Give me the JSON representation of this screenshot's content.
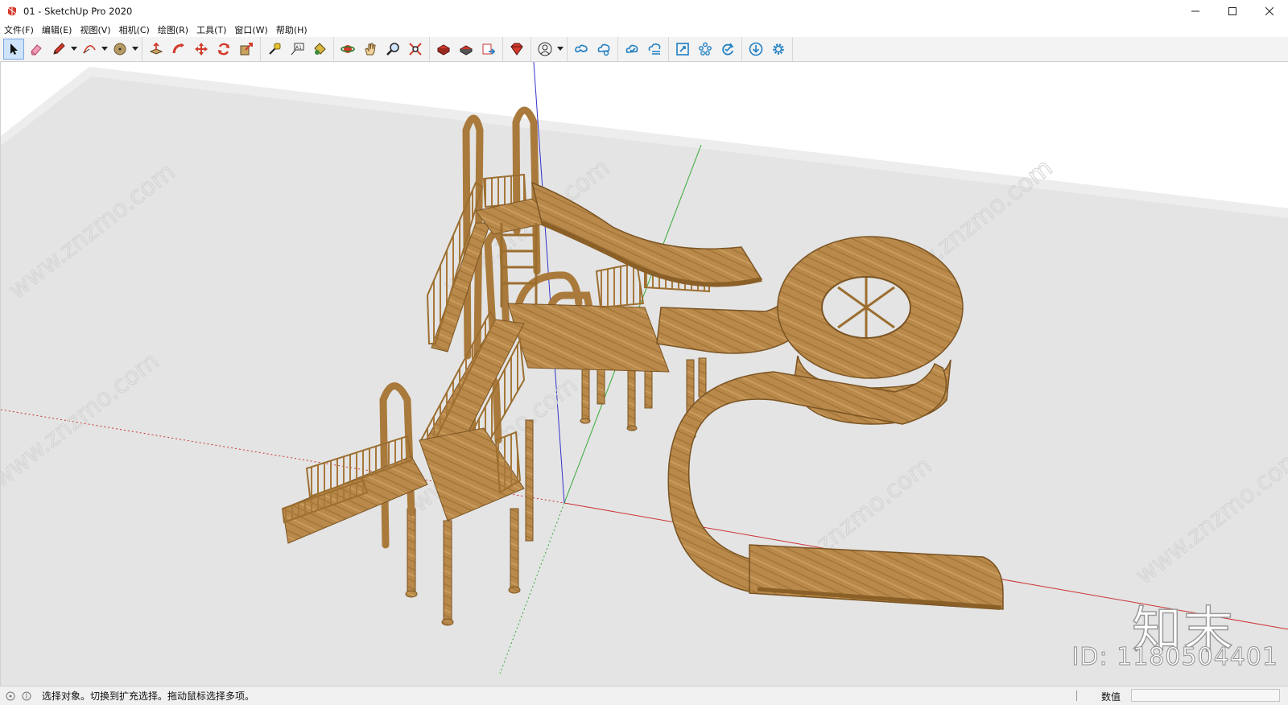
{
  "window": {
    "title": "01 - SketchUp Pro 2020",
    "icons": [
      "sketchup-logo-icon",
      "minimize-icon",
      "maximize-icon",
      "close-icon"
    ]
  },
  "menu": {
    "items": [
      {
        "label": "文件(F)"
      },
      {
        "label": "编辑(E)"
      },
      {
        "label": "视图(V)"
      },
      {
        "label": "相机(C)"
      },
      {
        "label": "绘图(R)"
      },
      {
        "label": "工具(T)"
      },
      {
        "label": "窗口(W)"
      },
      {
        "label": "帮助(H)"
      }
    ]
  },
  "toolbar": {
    "groups": [
      [
        "select-icon",
        "eraser-icon",
        "pencil-icon",
        "arc-icon",
        "circle-icon"
      ],
      [
        "push-pull-icon",
        "follow-me-icon",
        "move-icon",
        "rotate-icon",
        "scale-icon"
      ],
      [
        "tape-measure-icon",
        "text-label-icon",
        "paint-bucket-icon"
      ],
      [
        "orbit-icon",
        "pan-icon",
        "zoom-icon",
        "zoom-extents-icon"
      ],
      [
        "3d-warehouse-icon",
        "extension-warehouse-icon",
        "send-to-layout-icon"
      ],
      [
        "extension-manager-icon"
      ],
      [
        "account-icon"
      ],
      [
        "trimble-connect-icon",
        "trimble-share-icon"
      ],
      [
        "cloud-check-icon",
        "cloud-list-icon"
      ],
      [
        "scale-tool-icon",
        "components-icon",
        "refresh-icon"
      ],
      [
        "download-icon",
        "settings-icon"
      ]
    ],
    "accent": "#1f7fc4"
  },
  "viewport": {
    "background": "#ffffff",
    "ground_color": "#e6e6e6",
    "model_color": "#b58743",
    "axis_colors": {
      "red": "#cc3333",
      "green": "#33aa33",
      "blue": "#3333cc"
    },
    "watermark_text": "www.znzmo.com",
    "logo_text": "知末",
    "id_text": "ID: 1180504401"
  },
  "status": {
    "hint": "选择对象。切换到扩充选择。拖动鼠标选择多项。",
    "measure_label": "数值",
    "measure_value": ""
  }
}
